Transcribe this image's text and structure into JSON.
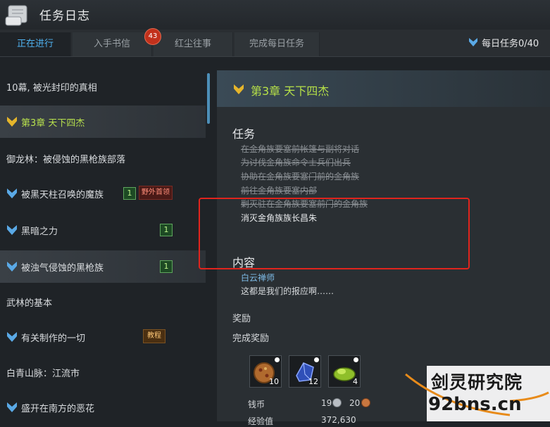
{
  "window": {
    "title": "任务日志"
  },
  "tabs": [
    {
      "label": "正在进行",
      "active": true
    },
    {
      "label": "入手书信",
      "badge": "43"
    },
    {
      "label": "红尘往事"
    },
    {
      "label": "完成每日任务"
    }
  ],
  "daily": {
    "label": "每日任务0/40"
  },
  "quest_list": [
    {
      "label": "10幕, 被光封印的真相",
      "type": "header"
    },
    {
      "label": "第3章 天下四杰",
      "type": "chapter",
      "selected": true
    },
    {
      "label": "御龙林：被侵蚀的黑枪族部落",
      "type": "header"
    },
    {
      "label": "被黑天柱召唤的魔族",
      "level": "1",
      "tag": "野外首领"
    },
    {
      "label": "黑暗之力",
      "level": "1"
    },
    {
      "label": "被浊气侵蚀的黑枪族",
      "level": "1",
      "highlighted": true
    },
    {
      "label": "武林的基本",
      "type": "header"
    },
    {
      "label": "有关制作的一切",
      "tag": "教程"
    },
    {
      "label": "白青山脉：江流市",
      "type": "header"
    },
    {
      "label": "盛开在南方的恶花"
    }
  ],
  "detail": {
    "chapter_title": "第3章 天下四杰",
    "task_heading": "任务",
    "tasks_done": [
      "在金角族要塞前帐篷与副将对话",
      "为讨伐金角族命令士兵们出兵",
      "协助在金角族要塞门前的金角族",
      "前往金角族要塞内部",
      "剿灭驻在金角族要塞前门的金角族"
    ],
    "task_current": "消灭金角族族长昌朱",
    "content_heading": "内容",
    "npc": "白云禅师",
    "dialog": "这都是我们的报应啊……",
    "reward_heading": "奖励",
    "complete_reward_heading": "完成奖励",
    "items": [
      {
        "icon": "pizza-food-icon",
        "count": "10"
      },
      {
        "icon": "blue-crystal-icon",
        "count": "12"
      },
      {
        "icon": "green-herb-icon",
        "count": "4"
      }
    ],
    "money_label": "钱币",
    "silver": "19",
    "copper": "20",
    "exp_label": "经验值",
    "exp_value": "372,630"
  },
  "watermark": {
    "line1": "剑灵研究院",
    "line2": "92bns.cn"
  },
  "colors": {
    "accent": "#4fb2f0",
    "chapter": "#b6e048",
    "annotation": "#e0241d"
  }
}
